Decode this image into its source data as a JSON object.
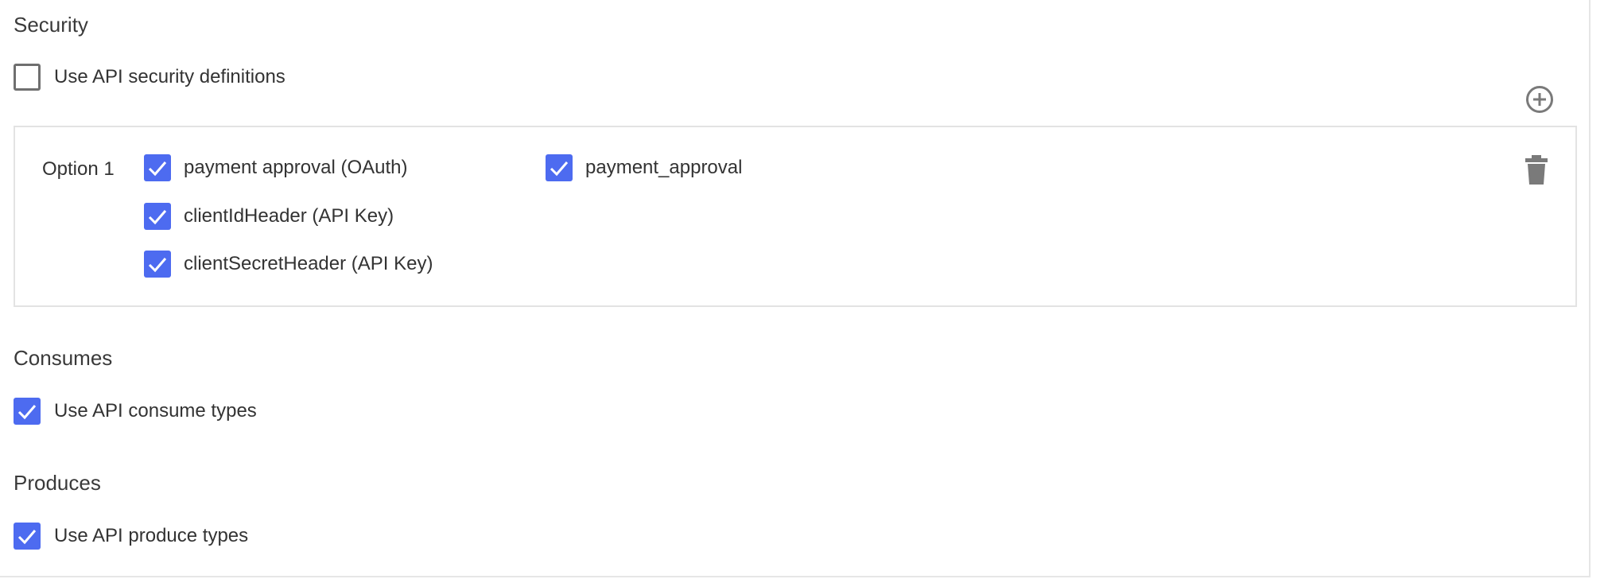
{
  "security": {
    "title": "Security",
    "use_definitions_label": "Use API security definitions",
    "use_definitions_checked": false,
    "add_icon": "plus-circle-icon",
    "option": {
      "label": "Option 1",
      "delete_icon": "trash-icon",
      "items": [
        {
          "label": "payment approval (OAuth)",
          "checked": true
        },
        {
          "label": "payment_approval",
          "checked": true
        },
        {
          "label": "clientIdHeader (API Key)",
          "checked": true
        },
        {
          "label": "clientSecretHeader (API Key)",
          "checked": true
        }
      ]
    }
  },
  "consumes": {
    "title": "Consumes",
    "use_label": "Use API consume types",
    "checked": true
  },
  "produces": {
    "title": "Produces",
    "use_label": "Use API produce types",
    "checked": true
  },
  "colors": {
    "accent": "#4d6bf0",
    "icon": "#7a7a7a",
    "border": "#e3e3e3"
  }
}
